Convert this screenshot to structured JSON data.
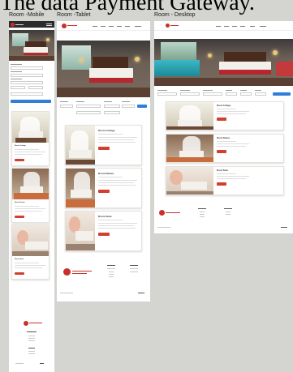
{
  "page": {
    "title": "The data Payment Gateway."
  },
  "frames": {
    "mobile_label": "Room -Mobile",
    "tablet_label": "Room -Tablet",
    "desktop_label": "Room - Desktop"
  },
  "colors": {
    "brand": "#c8302a",
    "button": "#d0402e",
    "search": "#2f7fd6"
  },
  "rooms": [
    {
      "name": "Room Cottage"
    },
    {
      "name": "Room Deluxe"
    },
    {
      "name": "Room Suite"
    }
  ]
}
